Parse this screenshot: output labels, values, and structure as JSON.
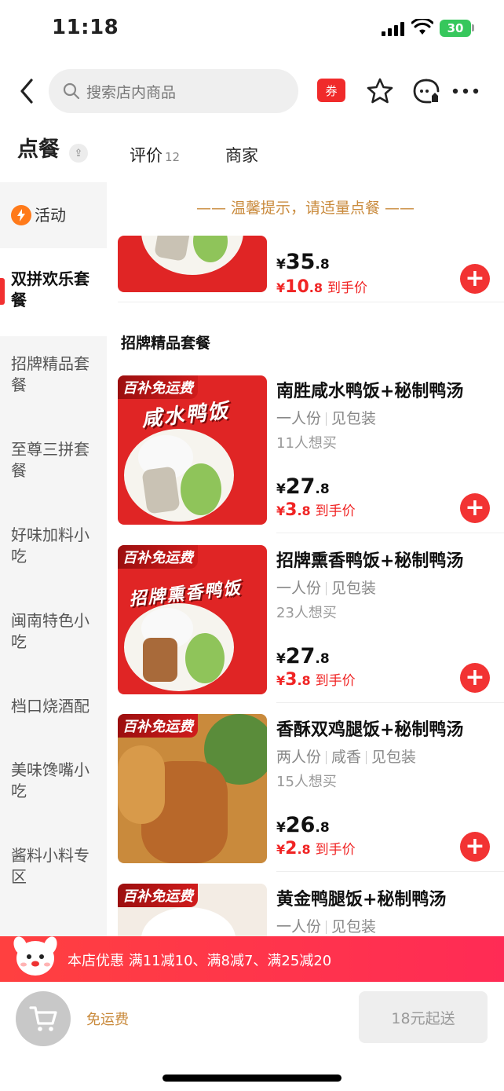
{
  "status_bar": {
    "time": "11:18",
    "battery": "30"
  },
  "header": {
    "search_placeholder": "搜索店内商品",
    "coupon_label": "券"
  },
  "tabs": {
    "order": "点餐",
    "reviews": "评价",
    "reviews_count": "12",
    "merchant": "商家"
  },
  "sidebar": {
    "items": [
      {
        "label": "活动"
      },
      {
        "label": "双拼欢乐套餐"
      },
      {
        "label": "招牌精品套餐"
      },
      {
        "label": "至尊三拼套餐"
      },
      {
        "label": "好味加料小吃"
      },
      {
        "label": "闽南特色小吃"
      },
      {
        "label": "档口烧酒配"
      },
      {
        "label": "美味馋嘴小吃"
      },
      {
        "label": "酱料小料专区"
      }
    ]
  },
  "main": {
    "tip": "—— 温馨提示，请适量点餐 ——",
    "partial_dish": {
      "price_int": "35",
      "price_dec": ".8",
      "sub_int": "10",
      "sub_dec": ".8",
      "sub_label": "到手价"
    },
    "section_title": "招牌精品套餐",
    "dishes": [
      {
        "name": "南胜咸水鸭饭+秘制鸭汤",
        "tags": [
          "一人份",
          "见包装"
        ],
        "want": "11人想买",
        "price_int": "27",
        "price_dec": ".8",
        "sub_int": "3",
        "sub_dec": ".8",
        "sub_label": "到手价",
        "badge": "百补免运费",
        "art": "咸水鸭饭"
      },
      {
        "name": "招牌熏香鸭饭+秘制鸭汤",
        "tags": [
          "一人份",
          "见包装"
        ],
        "want": "23人想买",
        "price_int": "27",
        "price_dec": ".8",
        "sub_int": "3",
        "sub_dec": ".8",
        "sub_label": "到手价",
        "badge": "百补免运费",
        "art": "招牌熏香鸭饭"
      },
      {
        "name": "香酥双鸡腿饭+秘制鸭汤",
        "tags": [
          "两人份",
          "咸香",
          "见包装"
        ],
        "want": "15人想买",
        "price_int": "26",
        "price_dec": ".8",
        "sub_int": "2",
        "sub_dec": ".8",
        "sub_label": "到手价",
        "badge": "百补免运费"
      },
      {
        "name": "黄金鸭腿饭+秘制鸭汤",
        "tags": [
          "一人份",
          "见包装"
        ],
        "badge": "百补免运费"
      }
    ],
    "yen": "¥"
  },
  "promo_banner": {
    "text": "本店优惠  满11减10、满8减7、满25减20"
  },
  "bottom_bar": {
    "free_shipping": "免运费",
    "min_order": "18元起送"
  },
  "colors": {
    "accent_red": "#f23030",
    "gold": "#c98a3c"
  }
}
